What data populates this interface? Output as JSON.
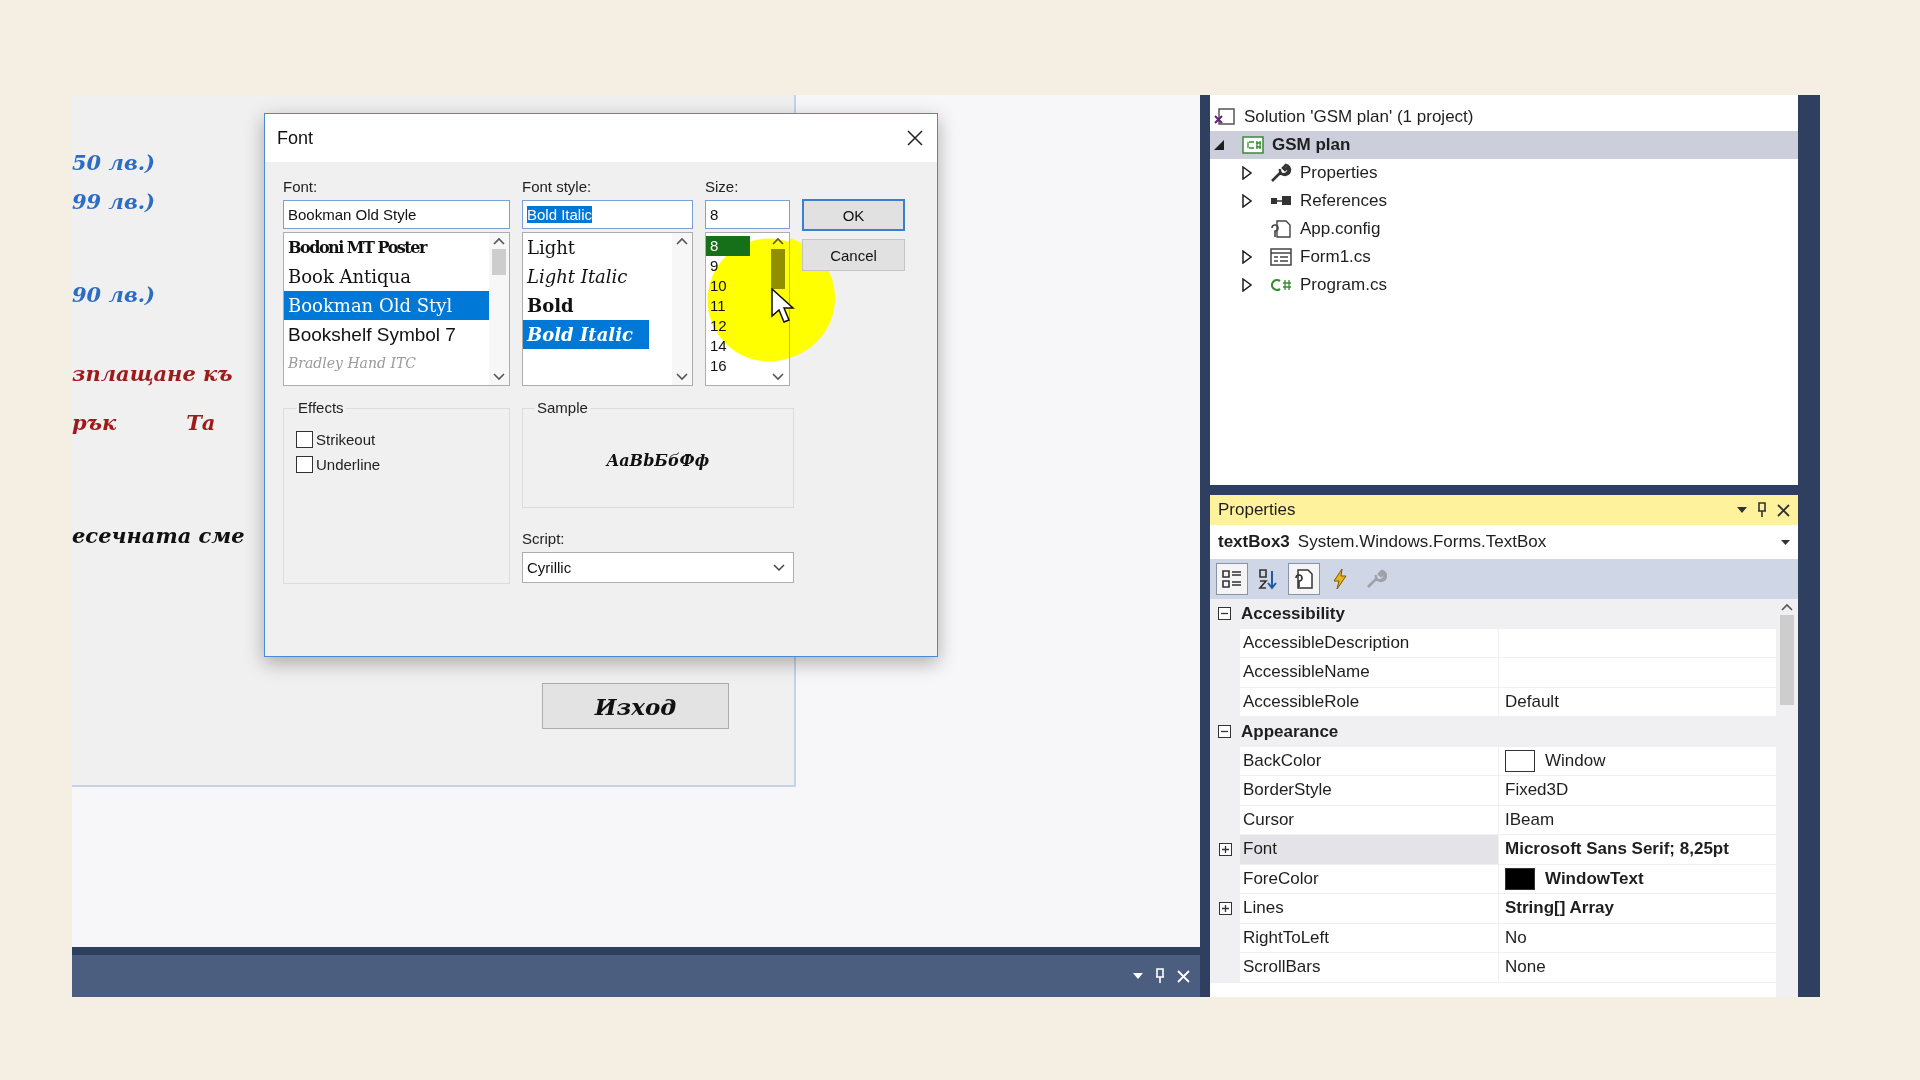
{
  "designer": {
    "lines": [
      {
        "parts": [
          "50 лв.)"
        ],
        "color": "#2b6cc4"
      },
      {
        "parts": [
          "99 лв.)"
        ],
        "color": "#2b6cc4"
      },
      {
        "parts": [
          "90 лв.)"
        ],
        "color": "#2b6cc4"
      },
      {
        "parts": [
          "зплащане къ"
        ],
        "color": "#9e1a1a"
      },
      {
        "parts": [
          "рък",
          "Та"
        ],
        "color": "#9e1a1a"
      },
      {
        "parts": [
          "есечната сме"
        ],
        "color": "#111111"
      }
    ],
    "exit_button": "Изход"
  },
  "font_dialog": {
    "title": "Font",
    "font": {
      "label": "Font:",
      "value": "Bookman Old Style",
      "items": [
        {
          "label": "Bodoni MT Poster",
          "kind": "condensed",
          "selected": false
        },
        {
          "label": "Book Antiqua",
          "kind": "serif",
          "selected": false
        },
        {
          "label": "Bookman Old Styl",
          "kind": "serif",
          "selected": true
        },
        {
          "label": "Bookshelf Symbol 7",
          "kind": "sans",
          "selected": false
        },
        {
          "label": "Bradley Hand ITC",
          "kind": "script",
          "selected": false
        }
      ]
    },
    "style": {
      "label": "Font style:",
      "value": "Bold Italic",
      "value_highlighted": true,
      "items": [
        {
          "label": "Light",
          "kind": "light",
          "selected": false
        },
        {
          "label": "Light Italic",
          "kind": "light-italic",
          "selected": false
        },
        {
          "label": "Bold",
          "kind": "bold",
          "selected": false
        },
        {
          "label": "Bold Italic",
          "kind": "bold-italic",
          "selected": true
        }
      ]
    },
    "size": {
      "label": "Size:",
      "value": "8",
      "items": [
        {
          "label": "8",
          "selected": true
        },
        {
          "label": "9",
          "selected": false
        },
        {
          "label": "10",
          "selected": false
        },
        {
          "label": "11",
          "selected": false
        },
        {
          "label": "12",
          "selected": false
        },
        {
          "label": "14",
          "selected": false
        },
        {
          "label": "16",
          "selected": false
        }
      ]
    },
    "buttons": [
      {
        "label": "OK",
        "default": true
      },
      {
        "label": "Cancel",
        "default": false
      }
    ],
    "effects": {
      "title": "Effects",
      "options": [
        {
          "label": "Strikeout",
          "checked": false
        },
        {
          "label": "Underline",
          "checked": false
        }
      ]
    },
    "sample": {
      "title": "Sample",
      "text": "AaBbБбФф"
    },
    "script": {
      "label": "Script:",
      "value": "Cyrillic"
    }
  },
  "solution_explorer": {
    "tree": [
      {
        "label": "Solution 'GSM plan' (1 project)",
        "kind": "solution",
        "selected": false,
        "children": [
          {
            "label": "GSM plan",
            "kind": "project",
            "expanded": true,
            "selected": true,
            "children": [
              {
                "label": "Properties",
                "kind": "wrench",
                "expanded": false,
                "selected": false
              },
              {
                "label": "References",
                "kind": "references",
                "expanded": false,
                "selected": false
              },
              {
                "label": "App.config",
                "kind": "config",
                "selected": false
              },
              {
                "label": "Form1.cs",
                "kind": "form",
                "expanded": false,
                "selected": false
              },
              {
                "label": "Program.cs",
                "kind": "csharp",
                "expanded": false,
                "selected": false
              }
            ]
          }
        ]
      }
    ]
  },
  "properties": {
    "title": "Properties",
    "object_name": "textBox3",
    "object_type": "System.Windows.Forms.TextBox",
    "toolbar": [
      {
        "kind": "categorized",
        "pressed": true
      },
      {
        "kind": "alphabetical",
        "pressed": false
      },
      {
        "kind": "property-pages",
        "pressed": true
      },
      {
        "kind": "events",
        "pressed": false
      },
      {
        "kind": "wrench",
        "pressed": false,
        "disabled": true
      }
    ],
    "categories": [
      {
        "name": "Accessibility",
        "expanded": true,
        "rows": [
          {
            "name": "AccessibleDescription",
            "bold": false,
            "selected": false
          },
          {
            "name": "AccessibleName",
            "bold": false,
            "selected": false
          },
          {
            "name": "AccessibleRole",
            "value": "Default",
            "bold": false,
            "selected": false
          }
        ]
      },
      {
        "name": "Appearance",
        "expanded": true,
        "rows": [
          {
            "name": "BackColor",
            "value": "Window",
            "color": "#ffffff",
            "bold": false,
            "selected": false
          },
          {
            "name": "BorderStyle",
            "value": "Fixed3D",
            "bold": false,
            "selected": false
          },
          {
            "name": "Cursor",
            "value": "IBeam",
            "bold": false,
            "selected": false
          },
          {
            "name": "Font",
            "value": "Microsoft Sans Serif; 8,25pt",
            "expandable": true,
            "bold": true,
            "selected": true
          },
          {
            "name": "ForeColor",
            "value": "WindowText",
            "color": "#000000",
            "bold": true,
            "selected": false
          },
          {
            "name": "Lines",
            "value": "String[] Array",
            "expandable": true,
            "bold": true,
            "selected": false
          },
          {
            "name": "RightToLeft",
            "value": "No",
            "bold": false,
            "selected": false
          },
          {
            "name": "ScrollBars",
            "value": "None",
            "bold": false,
            "selected": false
          }
        ]
      }
    ]
  }
}
